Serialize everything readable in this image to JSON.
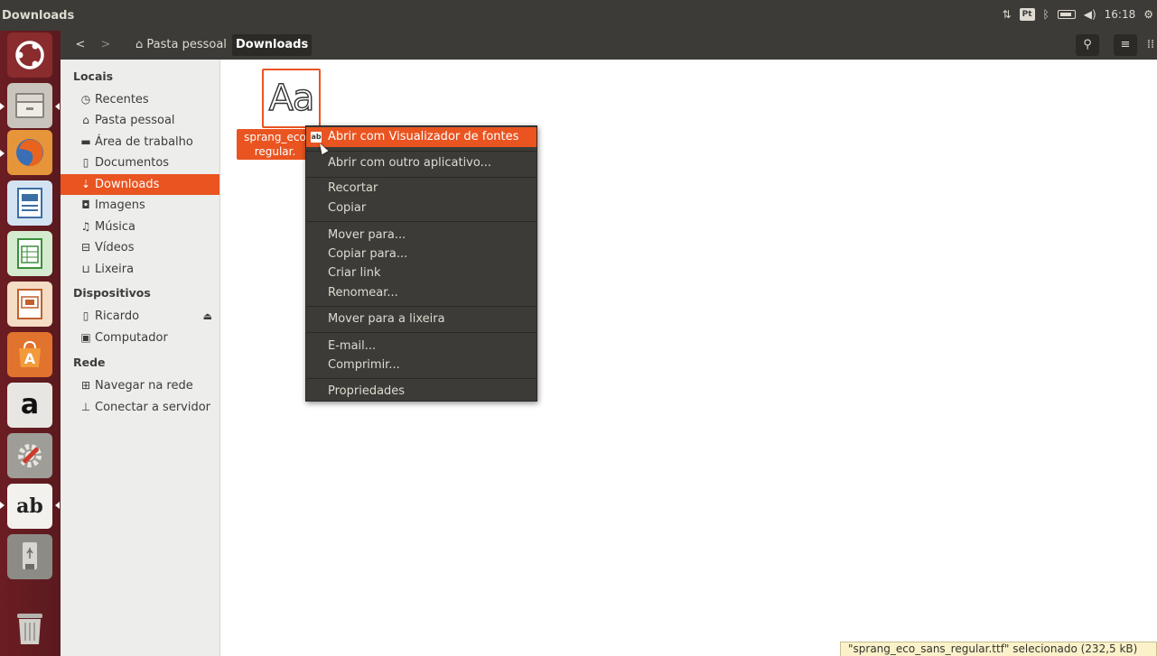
{
  "window": {
    "title": "Downloads"
  },
  "panel": {
    "keyboard_layout": "Pt",
    "time": "16:18"
  },
  "launcher": {
    "items": [
      {
        "name": "ubuntu-dash-icon"
      },
      {
        "name": "files-icon"
      },
      {
        "name": "firefox-icon"
      },
      {
        "name": "writer-icon"
      },
      {
        "name": "calc-icon"
      },
      {
        "name": "impress-icon"
      },
      {
        "name": "software-center-icon"
      },
      {
        "name": "amazon-icon",
        "label": "a"
      },
      {
        "name": "system-settings-icon"
      },
      {
        "name": "font-viewer-icon",
        "label": "ab"
      },
      {
        "name": "usb-drive-icon"
      },
      {
        "name": "trash-icon"
      }
    ]
  },
  "header": {
    "back": "<",
    "forward": ">",
    "crumb_home": "Pasta pessoal",
    "crumb_current": "Downloads"
  },
  "sidebar": {
    "sections": [
      "Locais",
      "Dispositivos",
      "Rede"
    ],
    "local_items": [
      {
        "label": "Recentes",
        "icon": "clock-icon"
      },
      {
        "label": "Pasta pessoal",
        "icon": "home-icon"
      },
      {
        "label": "Área de trabalho",
        "icon": "folder-icon"
      },
      {
        "label": "Documentos",
        "icon": "document-icon"
      },
      {
        "label": "Downloads",
        "icon": "download-icon",
        "active": true
      },
      {
        "label": "Imagens",
        "icon": "camera-icon"
      },
      {
        "label": "Música",
        "icon": "music-icon"
      },
      {
        "label": "Vídeos",
        "icon": "film-icon"
      },
      {
        "label": "Lixeira",
        "icon": "trash-icon"
      }
    ],
    "device_items": [
      {
        "label": "Ricardo",
        "icon": "usb-icon"
      },
      {
        "label": "Computador",
        "icon": "computer-icon"
      }
    ],
    "network_items": [
      {
        "label": "Navegar na rede",
        "icon": "network-icon"
      },
      {
        "label": "Conectar a servidor",
        "icon": "server-icon"
      }
    ]
  },
  "file": {
    "thumb_text": "Aa",
    "name_line1": "sprang_eco",
    "name_line2": "regular."
  },
  "context_menu": {
    "items": [
      "Abrir com Visualizador de fontes",
      "Abrir com outro aplicativo...",
      "Recortar",
      "Copiar",
      "Mover para...",
      "Copiar para...",
      "Criar link",
      "Renomear...",
      "Mover para a lixeira",
      "E-mail...",
      "Comprimir...",
      "Propriedades"
    ],
    "highlighted_index": 0
  },
  "status": {
    "text": "\"sprang_eco_sans_regular.ttf\" selecionado (232,5 kB)"
  },
  "colors": {
    "accent": "#e95420",
    "panel": "#3c3b37",
    "launcher": "#5e1b20",
    "sidebar": "#ededeb"
  }
}
